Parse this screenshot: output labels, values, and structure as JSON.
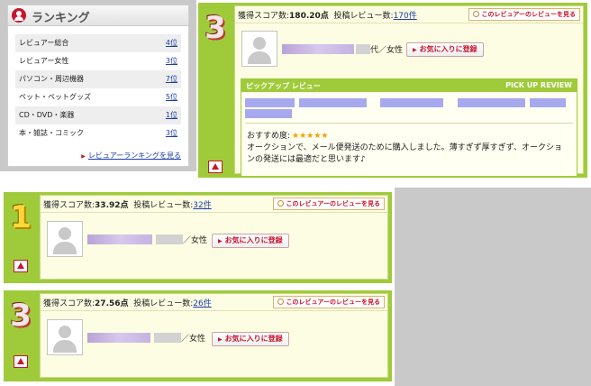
{
  "ranking": {
    "title": "ランキング",
    "items": [
      {
        "label": "レビュアー総合",
        "position": "4位"
      },
      {
        "label": "レビュアー女性",
        "position": "3位"
      },
      {
        "label": "パソコン・周辺機器",
        "position": "7位"
      },
      {
        "label": "ペット・ペットグッズ",
        "position": "5位"
      },
      {
        "label": "CD・DVD・楽器",
        "position": "1位"
      },
      {
        "label": "本・雑誌・コミック",
        "position": "3位"
      }
    ],
    "more_link": "レビュアーランキングを見る"
  },
  "cards": [
    {
      "medal": "3",
      "score_label": "獲得スコア数:",
      "score": "180.20点",
      "reviews_label": "投稿レビュー数:",
      "reviews": "170件",
      "view_button": "このレビュアーのレビューを見る",
      "name_suffix": "代",
      "gender": "／女性",
      "favorite_button": "お気に入りに登録",
      "pickup": {
        "header_left": "ピックアップ レビュー",
        "header_right": "PICK UP REVIEW",
        "rating_label": "おすすめ度:",
        "stars": "★★★★★",
        "text": "オークションで、メール便発送のために購入しました。薄すぎず厚すぎず、オークションの発送には最適だと思います♪"
      }
    },
    {
      "medal": "1",
      "score_label": "獲得スコア数:",
      "score": "33.92点",
      "reviews_label": "投稿レビュー数:",
      "reviews": "32件",
      "view_button": "このレビュアーのレビューを見る",
      "gender": "／女性",
      "favorite_button": "お気に入りに登録"
    },
    {
      "medal": "3",
      "score_label": "獲得スコア数:",
      "score": "27.56点",
      "reviews_label": "投稿レビュー数:",
      "reviews": "26件",
      "view_button": "このレビュアーのレビューを見る",
      "gender": "／女性",
      "favorite_button": "お気に入りに登録"
    }
  ],
  "colors": {
    "card_green": "#9fcb3a",
    "card_body": "#fdfde3",
    "accent_red": "#c8142c",
    "link_blue": "#1a3da8",
    "panel_gray": "#c9c9c9"
  }
}
